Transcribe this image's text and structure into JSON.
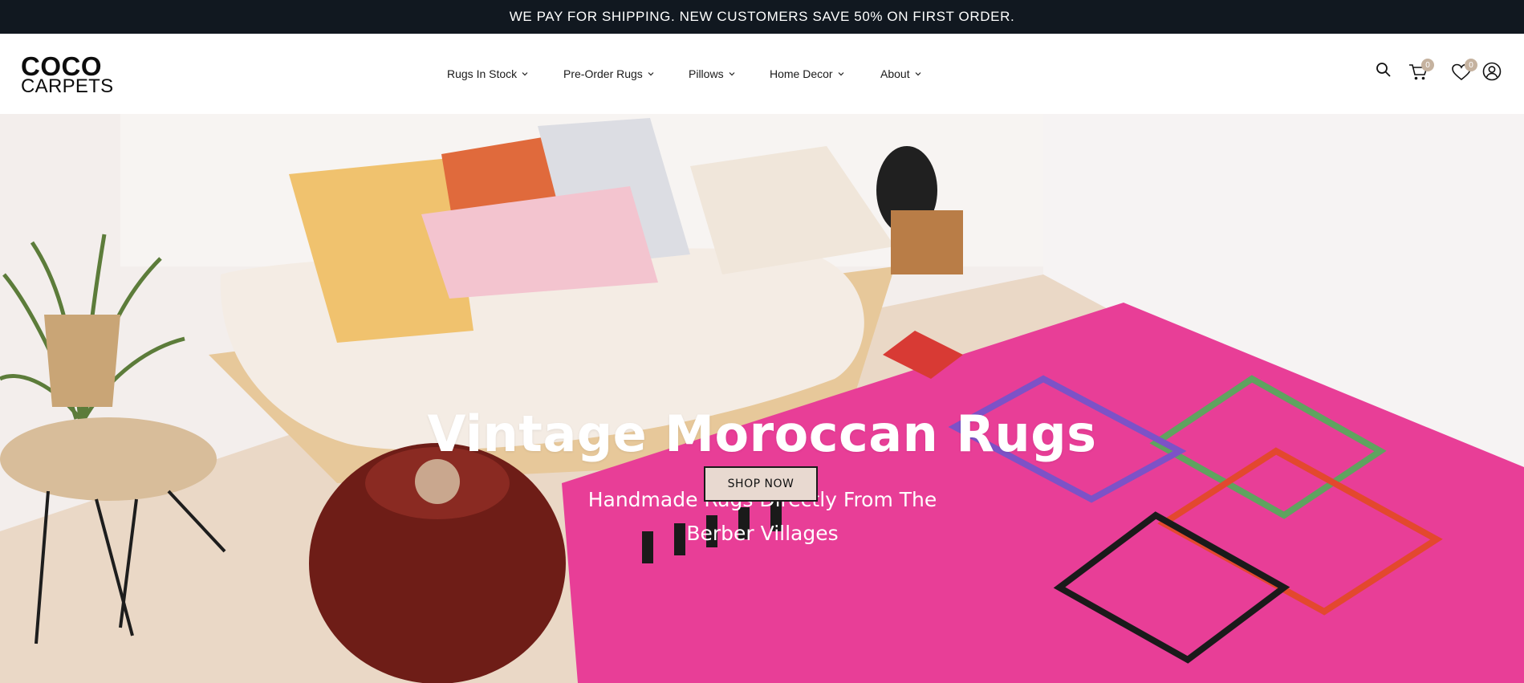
{
  "announcement": {
    "text": "WE PAY FOR SHIPPING. NEW CUSTOMERS SAVE 50% ON FIRST ORDER."
  },
  "brand": {
    "line1": "COCO",
    "line2": "CARPETS"
  },
  "nav": {
    "items": [
      {
        "label": "Rugs In Stock"
      },
      {
        "label": "Pre-Order Rugs"
      },
      {
        "label": "Pillows"
      },
      {
        "label": "Home Decor"
      },
      {
        "label": "About"
      }
    ]
  },
  "header_icons": {
    "search": "search-icon",
    "cart": "cart-icon",
    "cart_count": "0",
    "wishlist": "heart-icon",
    "wishlist_count": "0",
    "account": "user-icon"
  },
  "hero": {
    "title": "Vintage Moroccan Rugs",
    "subtitle": "Handmade Rugs Directly From The Berber Villages",
    "button_label": "SHOP NOW"
  },
  "colors": {
    "announcement_bg": "#111820",
    "badge": "#c5b29f",
    "button_bg": "#e8d9d0",
    "rug_pink": "#e83e97"
  }
}
